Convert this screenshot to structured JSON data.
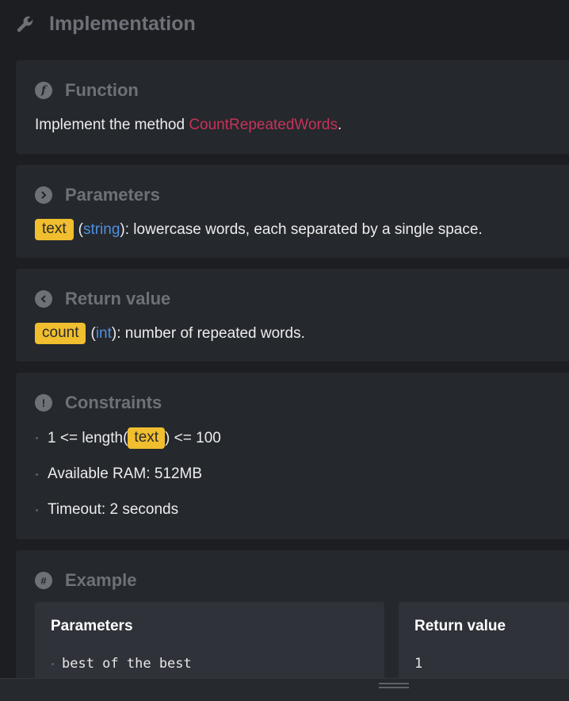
{
  "header": {
    "title": "Implementation",
    "icon": "wrench-icon"
  },
  "function_section": {
    "title": "Function",
    "icon": "function-icon",
    "text_before": "Implement the method ",
    "method_name": "CountRepeatedWords",
    "text_after": "."
  },
  "parameters_section": {
    "title": "Parameters",
    "icon": "chevron-right-circle-icon",
    "param_name": "text",
    "open_paren": "(",
    "param_type": "string",
    "description": "): lowercase words, each separated by a single space."
  },
  "return_section": {
    "title": "Return value",
    "icon": "chevron-left-circle-icon",
    "return_name": "count",
    "open_paren": "(",
    "return_type": "int",
    "description": "): number of repeated words."
  },
  "constraints_section": {
    "title": "Constraints",
    "icon": "exclamation-circle-icon",
    "c1_before": "1 <= length(",
    "c1_tag": "text",
    "c1_after": ") <= 100",
    "c2": "Available RAM: 512MB",
    "c3": "Timeout: 2 seconds"
  },
  "example_section": {
    "title": "Example",
    "icon": "hash-circle-icon",
    "parameters_header": "Parameters",
    "parameters_value": "best of the best",
    "return_header": "Return value",
    "return_value": "1"
  },
  "colors": {
    "background": "#1c1e22",
    "panel": "#25282d",
    "card": "#2f3238",
    "muted_title": "#6e7178",
    "method_name": "#c8325a",
    "tag_bg": "#f0be2e",
    "type_blue": "#4f8fde"
  }
}
